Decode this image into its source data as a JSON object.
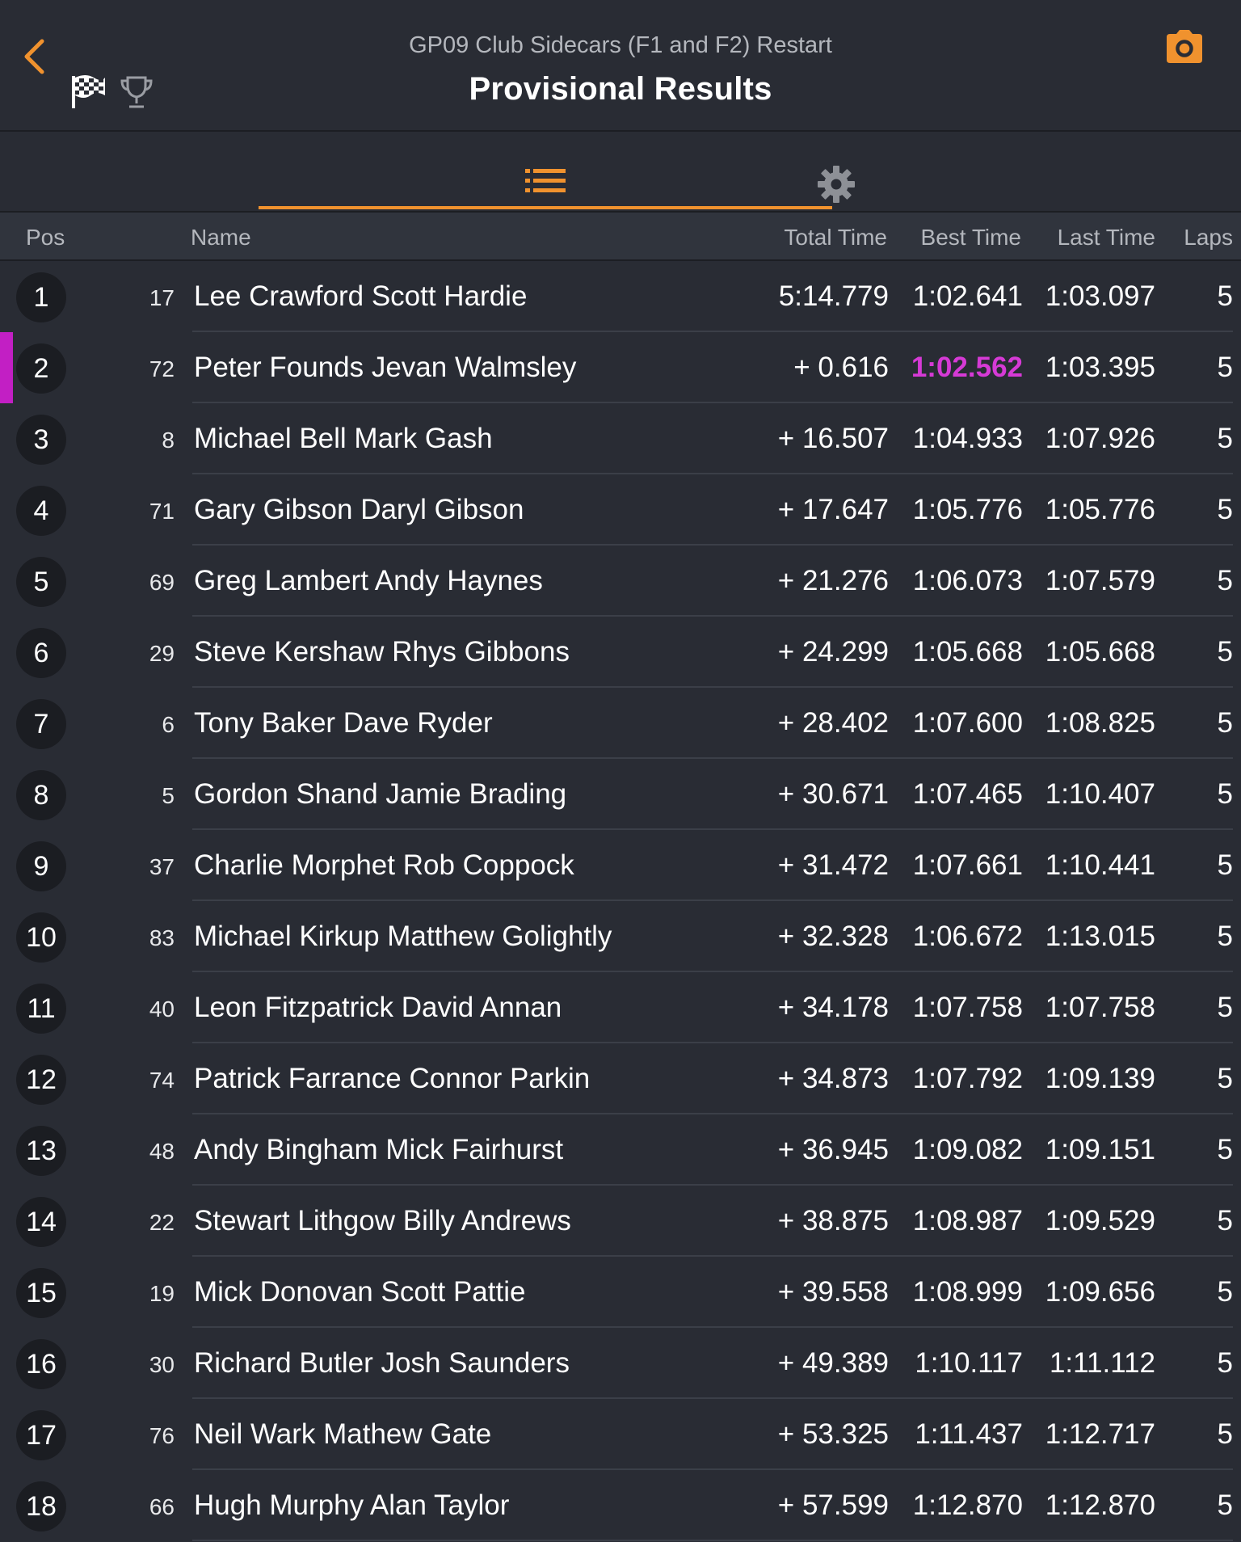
{
  "header": {
    "subtitle": "GP09 Club Sidecars (F1 and F2) Restart",
    "title": "Provisional Results",
    "accent_color": "#f0922e",
    "icons": [
      "chevron-left-icon",
      "checkered-flag-icon",
      "trophy-icon",
      "camera-icon"
    ]
  },
  "tabs": [
    {
      "icon": "list-icon",
      "active": true
    },
    {
      "icon": "gear-icon",
      "active": false
    }
  ],
  "columns": {
    "pos": "Pos",
    "name": "Name",
    "total": "Total Time",
    "best": "Best Time",
    "last": "Last Time",
    "laps": "Laps"
  },
  "highlight_color": "#c21fc4",
  "rows": [
    {
      "pos": "1",
      "num": "17",
      "name": "Lee Crawford Scott Hardie",
      "total": "5:14.779",
      "best": "1:02.641",
      "last": "1:03.097",
      "laps": "5"
    },
    {
      "pos": "2",
      "num": "72",
      "name": "Peter Founds Jevan Walmsley",
      "total": "+ 0.616",
      "best": "1:02.562",
      "last": "1:03.395",
      "laps": "5",
      "fastest": true
    },
    {
      "pos": "3",
      "num": "8",
      "name": "Michael Bell Mark Gash",
      "total": "+ 16.507",
      "best": "1:04.933",
      "last": "1:07.926",
      "laps": "5"
    },
    {
      "pos": "4",
      "num": "71",
      "name": "Gary Gibson Daryl Gibson",
      "total": "+ 17.647",
      "best": "1:05.776",
      "last": "1:05.776",
      "laps": "5"
    },
    {
      "pos": "5",
      "num": "69",
      "name": "Greg Lambert Andy Haynes",
      "total": "+ 21.276",
      "best": "1:06.073",
      "last": "1:07.579",
      "laps": "5"
    },
    {
      "pos": "6",
      "num": "29",
      "name": "Steve Kershaw Rhys Gibbons",
      "total": "+ 24.299",
      "best": "1:05.668",
      "last": "1:05.668",
      "laps": "5"
    },
    {
      "pos": "7",
      "num": "6",
      "name": "Tony Baker Dave Ryder",
      "total": "+ 28.402",
      "best": "1:07.600",
      "last": "1:08.825",
      "laps": "5"
    },
    {
      "pos": "8",
      "num": "5",
      "name": "Gordon Shand Jamie Brading",
      "total": "+ 30.671",
      "best": "1:07.465",
      "last": "1:10.407",
      "laps": "5"
    },
    {
      "pos": "9",
      "num": "37",
      "name": "Charlie Morphet Rob Coppock",
      "total": "+ 31.472",
      "best": "1:07.661",
      "last": "1:10.441",
      "laps": "5"
    },
    {
      "pos": "10",
      "num": "83",
      "name": "Michael Kirkup Matthew Golightly",
      "total": "+ 32.328",
      "best": "1:06.672",
      "last": "1:13.015",
      "laps": "5"
    },
    {
      "pos": "11",
      "num": "40",
      "name": "Leon Fitzpatrick David Annan",
      "total": "+ 34.178",
      "best": "1:07.758",
      "last": "1:07.758",
      "laps": "5"
    },
    {
      "pos": "12",
      "num": "74",
      "name": "Patrick Farrance Connor Parkin",
      "total": "+ 34.873",
      "best": "1:07.792",
      "last": "1:09.139",
      "laps": "5"
    },
    {
      "pos": "13",
      "num": "48",
      "name": "Andy Bingham Mick Fairhurst",
      "total": "+ 36.945",
      "best": "1:09.082",
      "last": "1:09.151",
      "laps": "5"
    },
    {
      "pos": "14",
      "num": "22",
      "name": "Stewart Lithgow Billy Andrews",
      "total": "+ 38.875",
      "best": "1:08.987",
      "last": "1:09.529",
      "laps": "5"
    },
    {
      "pos": "15",
      "num": "19",
      "name": "Mick Donovan Scott Pattie",
      "total": "+ 39.558",
      "best": "1:08.999",
      "last": "1:09.656",
      "laps": "5"
    },
    {
      "pos": "16",
      "num": "30",
      "name": "Richard Butler Josh Saunders",
      "total": "+ 49.389",
      "best": "1:10.117",
      "last": "1:11.112",
      "laps": "5"
    },
    {
      "pos": "17",
      "num": "76",
      "name": "Neil Wark Mathew Gate",
      "total": "+ 53.325",
      "best": "1:11.437",
      "last": "1:12.717",
      "laps": "5"
    },
    {
      "pos": "18",
      "num": "66",
      "name": "Hugh Murphy Alan Taylor",
      "total": "+ 57.599",
      "best": "1:12.870",
      "last": "1:12.870",
      "laps": "5"
    }
  ]
}
